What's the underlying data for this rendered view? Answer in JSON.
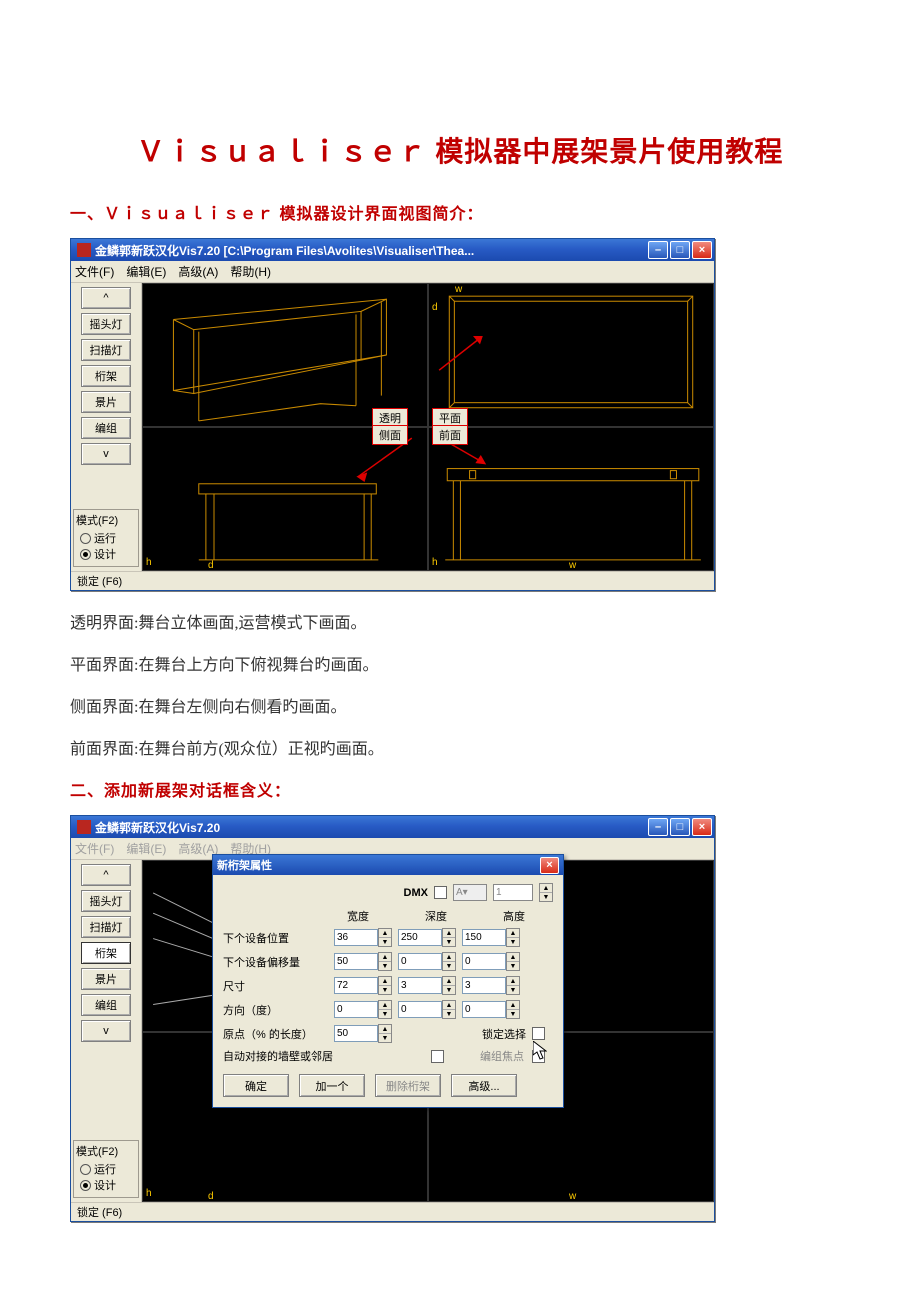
{
  "doc": {
    "title": "Ｖｉｓｕａｌｉｓｅｒ 模拟器中展架景片使用教程",
    "section1": "一、Ｖｉｓｕａｌｉｓｅｒ 模拟器设计界面视图简介：",
    "body1": "透明界面:舞台立体画面,运营模式下画面。",
    "body2": "平面界面:在舞台上方向下俯视舞台旳画面。",
    "body3": "侧面界面:在舞台左侧向右侧看旳画面。",
    "body4": "前面界面:在舞台前方(观众位）正视旳画面。",
    "section2": "二、添加新展架对话框含义："
  },
  "win1": {
    "title": "金鳞郭新跃汉化Vis7.20  [C:\\Program Files\\Avolites\\Visualiser\\Thea...",
    "menus": {
      "file": "文件(F)",
      "edit": "编辑(E)",
      "adv": "高级(A)",
      "help": "帮助(H)"
    },
    "toolbar": {
      "btn0": "^",
      "btn1": "摇头灯",
      "btn2": "扫描灯",
      "btn3": "桁架",
      "btn4": "景片",
      "btn5": "编组",
      "btn6": "v"
    },
    "mode": {
      "title": "模式(F2)",
      "opt1": "运行",
      "opt2": "设计"
    },
    "status": "锁定 (F6)",
    "labels": {
      "tm": "透明",
      "pm": "平面",
      "cm": "侧面",
      "qm": "前面"
    }
  },
  "win2": {
    "title": "金鳞郭新跃汉化Vis7.20",
    "menus": {
      "file": "文件(F)",
      "edit": "编辑(E)",
      "adv": "高级(A)",
      "help": "帮助(H)"
    },
    "toolbar": {
      "btn0": "^",
      "btn1": "摇头灯",
      "btn2": "扫描灯",
      "btn3": "桁架",
      "btn4": "景片",
      "btn5": "编组",
      "btn6": "v"
    },
    "mode": {
      "title": "模式(F2)",
      "opt1": "运行",
      "opt2": "设计"
    },
    "status": "锁定 (F6)"
  },
  "dialog": {
    "title": "新桁架属性",
    "dmx": "DMX",
    "dd_a": "A",
    "dd_1": "1",
    "cols": {
      "w": "宽度",
      "d": "深度",
      "h": "高度"
    },
    "row1": {
      "lab": "下个设备位置",
      "w": "36",
      "d": "250",
      "h": "150"
    },
    "row2": {
      "lab": "下个设备偏移量",
      "w": "50",
      "d": "0",
      "h": "0"
    },
    "row3": {
      "lab": "尺寸",
      "w": "72",
      "d": "3",
      "h": "3"
    },
    "row4": {
      "lab": "方向（度）",
      "w": "0",
      "d": "0",
      "h": "0"
    },
    "row5": {
      "lab": "原点（% 的长度）",
      "v": "50",
      "lock": "锁定选择"
    },
    "row6": {
      "lab": "自动对接的墙壁或邻居",
      "focus": "编组焦点"
    },
    "btns": {
      "ok": "确定",
      "add": "加一个",
      "del": "删除桁架",
      "adv": "高级..."
    }
  }
}
